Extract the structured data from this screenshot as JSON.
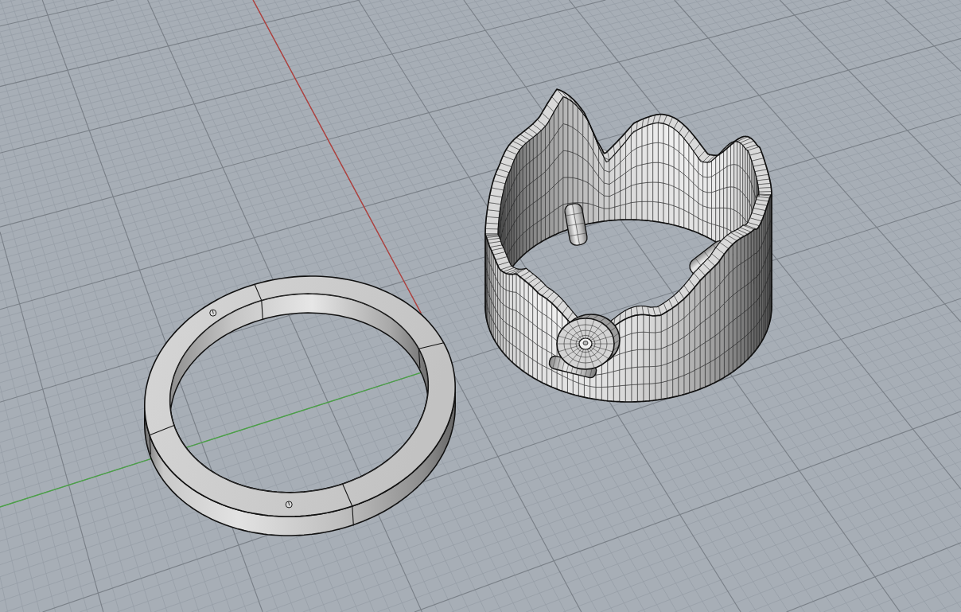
{
  "viewport": {
    "grid": {
      "visible": true
    },
    "axes": [
      {
        "kind": "x",
        "color": "#b3403d"
      },
      {
        "kind": "y",
        "color": "#4aa245"
      }
    ],
    "objects": [
      {
        "kind": "band-ring"
      },
      {
        "kind": "crown-ring"
      }
    ]
  }
}
